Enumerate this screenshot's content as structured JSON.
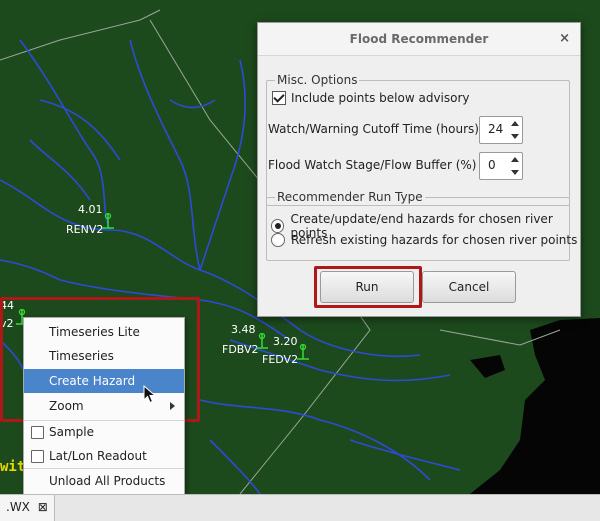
{
  "map": {
    "gauges": [
      {
        "value": "4.01",
        "id": "RENV2"
      },
      {
        "value": "3.48",
        "id": "FDBV2"
      },
      {
        "value": "3.20",
        "id": "FEDV2"
      }
    ],
    "partial_left_value": "44",
    "partial_left_id": "v2",
    "partial_text": "wit"
  },
  "dialog": {
    "title": "Flood Recommender",
    "close_icon": "×",
    "misc_group_title": "Misc. Options",
    "include_below_advisory_label": "Include points below advisory",
    "include_below_advisory_checked": true,
    "cutoff_label": "Watch/Warning Cutoff Time (hours)",
    "cutoff_value": "24",
    "buffer_label": "Flood Watch Stage/Flow Buffer (%)",
    "buffer_value": "0",
    "run_type_group_title": "Recommender Run Type",
    "run_type_options": [
      {
        "label": "Create/update/end hazards for chosen river points",
        "selected": true
      },
      {
        "label": "Refresh existing hazards for chosen river points",
        "selected": false
      }
    ],
    "run_button": "Run",
    "cancel_button": "Cancel"
  },
  "context_menu": {
    "items": [
      {
        "label": "Timeseries Lite"
      },
      {
        "label": "Timeseries"
      },
      {
        "label": "Create Hazard",
        "selected": true
      },
      {
        "label": "Zoom",
        "submenu": true
      },
      {
        "label": "Sample",
        "checkbox": true
      },
      {
        "label": "Lat/Lon Readout",
        "checkbox": true
      },
      {
        "label": "Unload All Products"
      }
    ]
  },
  "bottom_tab": {
    "label": ".WX",
    "close_icon": "⊠"
  },
  "colors": {
    "map_bg": "#1d4a1d",
    "river": "#2d4bd6",
    "highlight": "#b01717",
    "menu_selected": "#4a85cc",
    "gauge_icon": "#33dd33"
  }
}
